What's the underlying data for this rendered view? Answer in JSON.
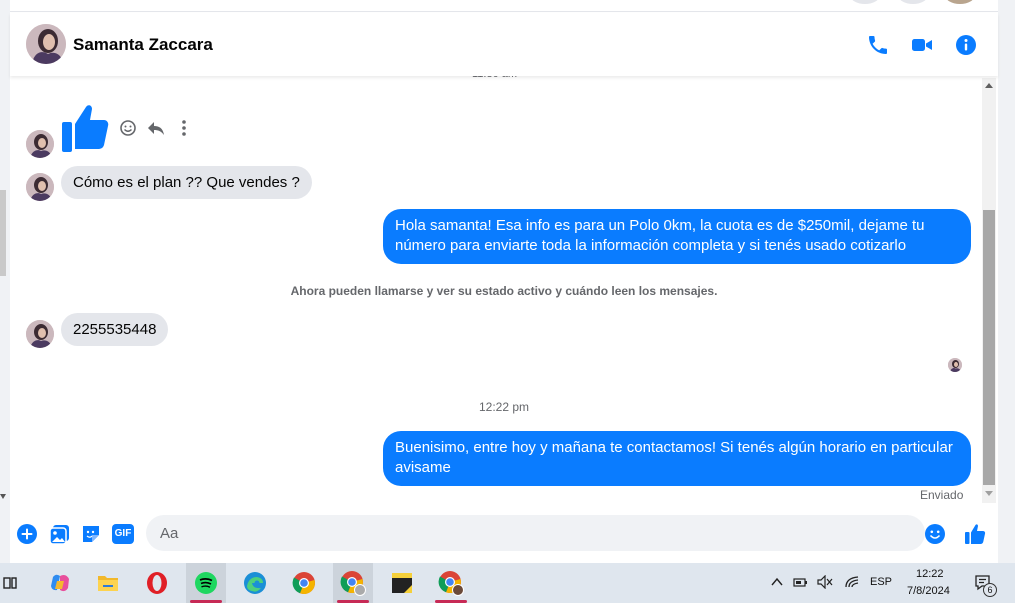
{
  "contact": {
    "name": "Samanta Zaccara"
  },
  "header_actions": [
    "phone-icon",
    "video-icon",
    "info-icon"
  ],
  "colors": {
    "accent": "#0a7cff",
    "incoming_bubble": "#e4e6eb",
    "muted_text": "#65676b"
  },
  "messages": [
    {
      "sender": "contact",
      "type": "reaction",
      "content": "thumbs-up-icon"
    },
    {
      "sender": "contact",
      "type": "text",
      "text": "Cómo es el plan ?? Que vendes ?"
    },
    {
      "sender": "me",
      "type": "text",
      "lines": [
        "Hola samanta! Esa info es para un Polo 0km, la cuota es de $250mil, dejame tu",
        "número para enviarte toda la información completa y si tenés usado cotizarlo"
      ]
    },
    {
      "sender": "system",
      "type": "notice",
      "text": "Ahora pueden llamarse y ver su estado activo y cuándo leen los mensajes."
    },
    {
      "sender": "contact",
      "type": "text",
      "text": "2255535448"
    },
    {
      "sender": "system",
      "type": "timestamp",
      "text": "12:22 pm"
    },
    {
      "sender": "me",
      "type": "text",
      "lines": [
        "Buenisimo, entre hoy y mañana te contactamos! Si tenés algún horario en particular",
        "avisame"
      ]
    }
  ],
  "message_actions": [
    "emoji-react-icon",
    "reply-icon",
    "more-options-icon"
  ],
  "delivery_status": "Enviado",
  "composer": {
    "placeholder": "Aa",
    "value": "",
    "buttons": [
      "add-icon",
      "photo-icon",
      "sticker-icon",
      "gif-icon"
    ],
    "right_buttons": [
      "emoji-icon",
      "thumbs-up-icon"
    ],
    "gif_label": "GIF"
  },
  "taskbar": {
    "apps": [
      "task-view-icon",
      "copilot-icon",
      "file-explorer-icon",
      "opera-icon",
      "spotify-icon",
      "edge-icon",
      "chrome-icon",
      "chrome-profile-icon",
      "sticky-notes-icon",
      "chrome-profile-2-icon"
    ],
    "language": "ESP",
    "time": "12:22",
    "date": "7/8/2024",
    "notifications": "6"
  }
}
